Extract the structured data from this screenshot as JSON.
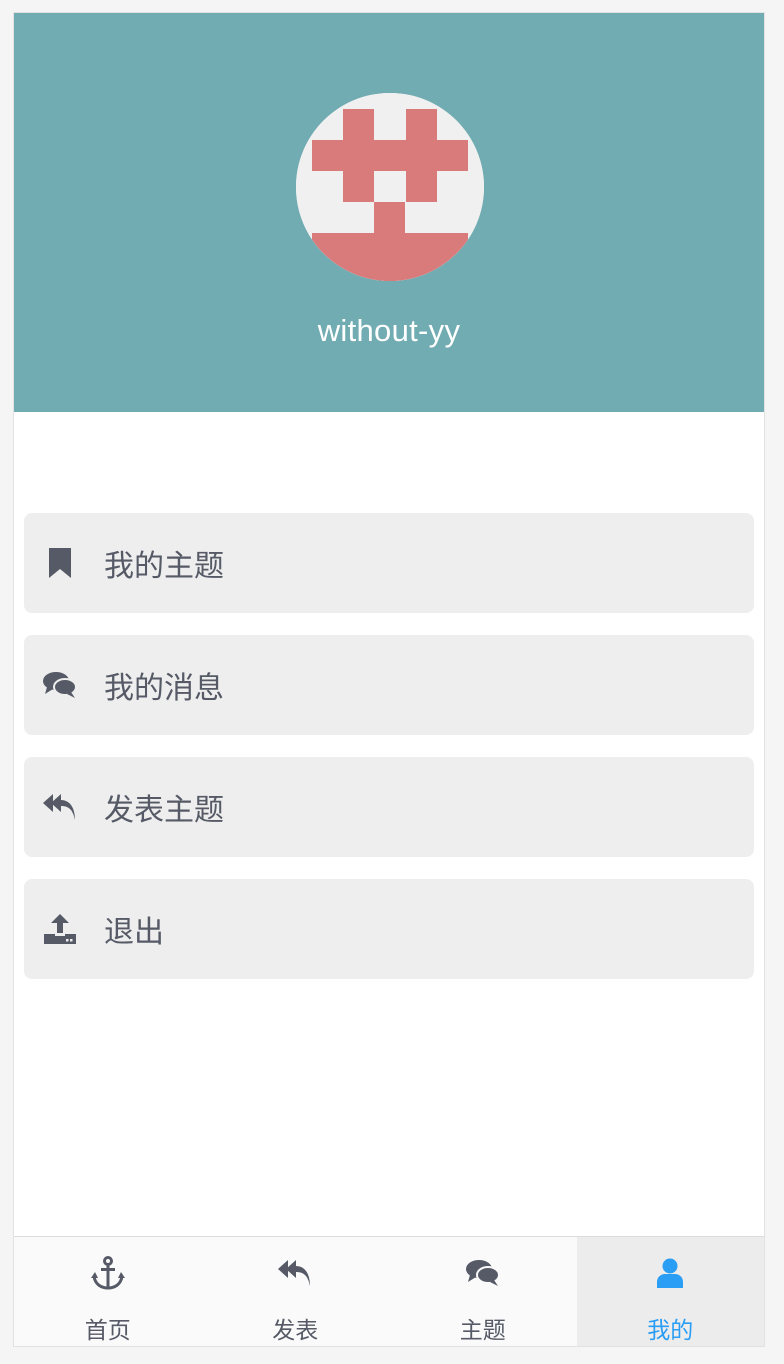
{
  "profile": {
    "username": "without-yy",
    "avatar_icon": "identicon-avatar",
    "header_color": "#71acb2",
    "avatar_color": "#d97b7b"
  },
  "menu": {
    "items": [
      {
        "label": "我的主题",
        "icon": "bookmark-icon"
      },
      {
        "label": "我的消息",
        "icon": "comments-icon"
      },
      {
        "label": "发表主题",
        "icon": "reply-all-icon"
      },
      {
        "label": "退出",
        "icon": "upload-icon"
      }
    ]
  },
  "tabbar": {
    "active_color": "#2a9df4",
    "items": [
      {
        "label": "首页",
        "icon": "anchor-icon",
        "active": false
      },
      {
        "label": "发表",
        "icon": "reply-all-icon",
        "active": false
      },
      {
        "label": "主题",
        "icon": "comments-icon",
        "active": false
      },
      {
        "label": "我的",
        "icon": "user-icon",
        "active": true
      }
    ]
  }
}
